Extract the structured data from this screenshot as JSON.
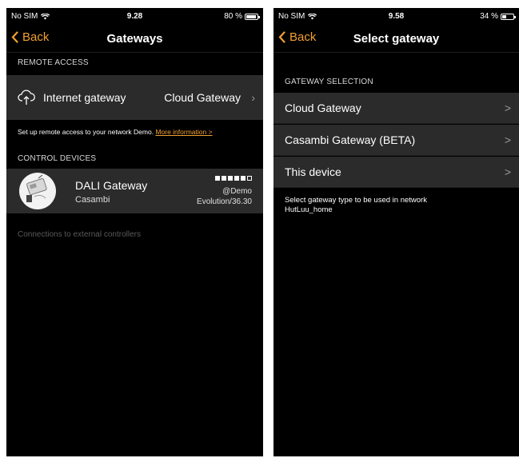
{
  "left": {
    "status": {
      "carrier": "No SIM",
      "time": "9.28",
      "battery": "80 %",
      "battery_level": 0.8
    },
    "nav": {
      "back_label": "Back",
      "title": "Gateways"
    },
    "remote_access": {
      "header": "REMOTE ACCESS",
      "internet_label": "Internet gateway",
      "internet_value": "Cloud Gateway",
      "chevron": "›",
      "note_text": "Set up remote access to your network Demo. ",
      "note_link": "More information >"
    },
    "control_devices": {
      "header": "CONTROL DEVICES",
      "device": {
        "name": "DALI Gateway",
        "vendor": "Casambi",
        "network": "@Demo",
        "firmware": "Evolution/36.30",
        "signal_bars_on": 5,
        "signal_bars_total": 6
      }
    },
    "external_note": "Connections to external controllers"
  },
  "right": {
    "status": {
      "carrier": "No SIM",
      "time": "9.58",
      "battery": "34 %",
      "battery_level": 0.34
    },
    "nav": {
      "back_label": "Back",
      "title": "Select gateway"
    },
    "section_header": "GATEWAY SELECTION",
    "options": [
      {
        "label": "Cloud Gateway",
        "chevron": ">"
      },
      {
        "label": "Casambi Gateway (BETA)",
        "chevron": ">"
      },
      {
        "label": "This device",
        "chevron": ">"
      }
    ],
    "footer_note_line1": "Select gateway type to be used in network",
    "footer_note_line2": "HutLuu_home"
  }
}
